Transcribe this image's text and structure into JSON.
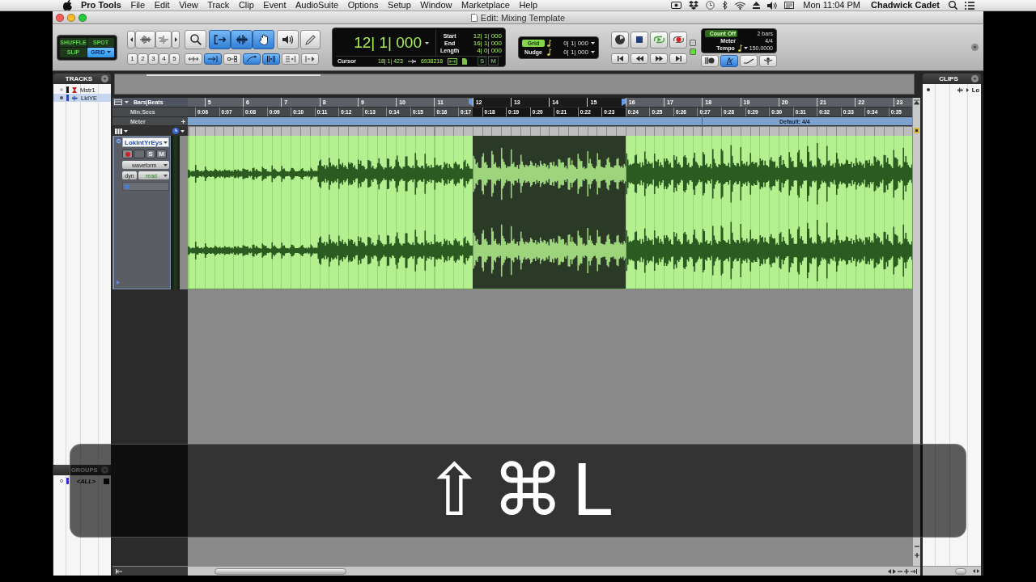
{
  "menu_bar": {
    "app": "Pro Tools",
    "items": [
      "File",
      "Edit",
      "View",
      "Track",
      "Clip",
      "Event",
      "AudioSuite",
      "Options",
      "Setup",
      "Window",
      "Marketplace",
      "Help"
    ],
    "clock": "Mon 11:04 PM",
    "user": "Chadwick Cadet"
  },
  "window": {
    "title": "Edit: Mixing Template"
  },
  "toolbar": {
    "edit_modes": [
      {
        "label": "SHUFFLE",
        "selected": false
      },
      {
        "label": "SPOT",
        "selected": false
      },
      {
        "label": "SLIP",
        "selected": false
      },
      {
        "label": "GRID",
        "selected": true
      }
    ],
    "zoom_presets": [
      "1",
      "2",
      "3",
      "4",
      "5"
    ],
    "tools": [
      {
        "kind": "zoomer",
        "selected": false
      },
      {
        "kind": "trim",
        "selected": true
      },
      {
        "kind": "selector",
        "selected": true
      },
      {
        "kind": "grabber",
        "selected": true
      },
      {
        "kind": "scrubber",
        "selected": false
      },
      {
        "kind": "pencil",
        "selected": false
      }
    ],
    "edit_options": [
      {
        "kind": "zoom_toggle",
        "on": false
      },
      {
        "kind": "tab_transient",
        "on": true
      },
      {
        "kind": "link_timeline",
        "on": false
      },
      {
        "kind": "link_track",
        "on": true
      },
      {
        "kind": "insertion_follows",
        "on": true
      },
      {
        "kind": "mirror",
        "on": false
      },
      {
        "kind": "keyboard_focus",
        "on": false
      }
    ],
    "counter": {
      "main": "12| 1| 000",
      "rows": [
        {
          "label": "Start",
          "value": "12| 1| 000"
        },
        {
          "label": "End",
          "value": "16| 1| 000"
        },
        {
          "label": "Length",
          "value": "4| 0| 000"
        }
      ],
      "cursor_label": "Cursor",
      "cursor": "18| 1| 423",
      "samples": "6938218",
      "flags": [
        "S",
        "M"
      ]
    },
    "grid_nudge": [
      {
        "label": "Grid",
        "value": "0| 1| 000",
        "selected": true
      },
      {
        "label": "Nudge",
        "value": "0| 1| 000",
        "selected": false
      }
    ],
    "transport_indicators": [
      {
        "on": false
      },
      {
        "on": true
      }
    ],
    "tempo_panel": {
      "rows": [
        {
          "label": "Count Off",
          "value": "2 bars",
          "kind": "toggle",
          "on": true
        },
        {
          "label": "Meter",
          "value": "4/4",
          "kind": "plain",
          "on": false
        },
        {
          "label": "Tempo",
          "value": "150.0000",
          "kind": "tempo",
          "on": false
        }
      ],
      "buttons": [
        {
          "kind": "wait_note",
          "on": false
        },
        {
          "kind": "metronome",
          "on": true
        },
        {
          "kind": "conductor",
          "on": false
        },
        {
          "kind": "tempo_map",
          "on": false
        }
      ]
    }
  },
  "tracks_panel": {
    "title": "TRACKS",
    "items": [
      {
        "name": "Mstr1",
        "kind": "master",
        "color": "#1a1a1a",
        "selected": false
      },
      {
        "name": "LkIYE",
        "kind": "audio",
        "color": "#2a4aa8",
        "selected": true
      }
    ]
  },
  "groups_panel": {
    "title": "GROUPS",
    "items": [
      {
        "name": "<ALL>",
        "color": "#3b2bd6"
      }
    ]
  },
  "rulers": {
    "bars_label": "Bars|Beats",
    "bars": [
      {
        "label": "5",
        "selected": false,
        "playhead": false
      },
      {
        "label": "6",
        "selected": false,
        "playhead": false
      },
      {
        "label": "7",
        "selected": false,
        "playhead": false
      },
      {
        "label": "8",
        "selected": false,
        "playhead": false
      },
      {
        "label": "9",
        "selected": false,
        "playhead": false
      },
      {
        "label": "10",
        "selected": false,
        "playhead": false
      },
      {
        "label": "11",
        "selected": false,
        "playhead": false
      },
      {
        "label": "12",
        "selected": true,
        "playhead": false
      },
      {
        "label": "13",
        "selected": true,
        "playhead": false
      },
      {
        "label": "14",
        "selected": true,
        "playhead": false
      },
      {
        "label": "15",
        "selected": true,
        "playhead": false
      },
      {
        "label": "16",
        "selected": false,
        "playhead": false
      },
      {
        "label": "17",
        "selected": false,
        "playhead": false
      },
      {
        "label": "18",
        "selected": false,
        "playhead": true
      },
      {
        "label": "19",
        "selected": false,
        "playhead": false
      },
      {
        "label": "20",
        "selected": false,
        "playhead": false
      },
      {
        "label": "21",
        "selected": false,
        "playhead": false
      },
      {
        "label": "22",
        "selected": false,
        "playhead": false
      },
      {
        "label": "23",
        "selected": false,
        "playhead": false
      }
    ],
    "secs_label": "Min:Secs",
    "secs": [
      "0:06",
      "0:07",
      "0:08",
      "0:09",
      "0:10",
      "0:11",
      "0:12",
      "0:13",
      "0:14",
      "0:15",
      "0:16",
      "0:17",
      "0:18",
      "0:19",
      "0:20",
      "0:21",
      "0:22",
      "0:23",
      "0:24",
      "0:25",
      "0:26",
      "0:27",
      "0:28",
      "0:29",
      "0:30",
      "0:31",
      "0:32",
      "0:33",
      "0:34",
      "0:35"
    ],
    "meter_label": "Meter",
    "meter_value": "Default: 4/4"
  },
  "track": {
    "name": "LokIntYrEys",
    "record_armed": false,
    "solo_label": "S",
    "solo": false,
    "mute_label": "M",
    "mute": false,
    "view": "waveform",
    "mode": "dyn",
    "automation": "read"
  },
  "clips_panel": {
    "title": "CLIPS",
    "items": [
      "Lo"
    ]
  },
  "shortcut_overlay": {
    "keys": [
      "⇧",
      "⌘",
      "L"
    ]
  }
}
